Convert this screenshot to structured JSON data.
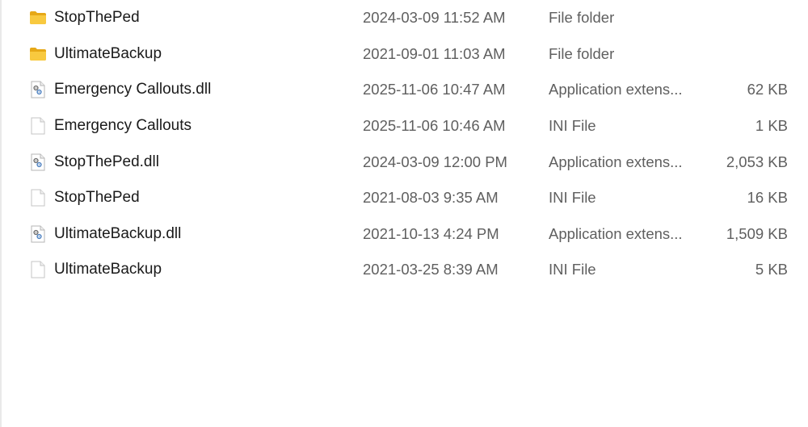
{
  "files": [
    {
      "name": "StopThePed",
      "date": "2024-03-09 11:52 AM",
      "type": "File folder",
      "size": "",
      "icon": "folder-icon"
    },
    {
      "name": "UltimateBackup",
      "date": "2021-09-01 11:03 AM",
      "type": "File folder",
      "size": "",
      "icon": "folder-icon"
    },
    {
      "name": "Emergency Callouts.dll",
      "date": "2025-11-06 10:47 AM",
      "type": "Application extens...",
      "size": "62 KB",
      "icon": "dll-file-icon"
    },
    {
      "name": "Emergency Callouts",
      "date": "2025-11-06 10:46 AM",
      "type": "INI File",
      "size": "1 KB",
      "icon": "ini-file-icon"
    },
    {
      "name": "StopThePed.dll",
      "date": "2024-03-09 12:00 PM",
      "type": "Application extens...",
      "size": "2,053 KB",
      "icon": "dll-file-icon"
    },
    {
      "name": "StopThePed",
      "date": "2021-08-03 9:35 AM",
      "type": "INI File",
      "size": "16 KB",
      "icon": "ini-file-icon"
    },
    {
      "name": "UltimateBackup.dll",
      "date": "2021-10-13 4:24 PM",
      "type": "Application extens...",
      "size": "1,509 KB",
      "icon": "dll-file-icon"
    },
    {
      "name": "UltimateBackup",
      "date": "2021-03-25 8:39 AM",
      "type": "INI File",
      "size": "5 KB",
      "icon": "ini-file-icon"
    }
  ],
  "colors": {
    "folder": "#f8c93f",
    "folder_dark": "#e6a817",
    "text_primary": "#1a1a1a",
    "text_secondary": "#5f5f5f"
  }
}
